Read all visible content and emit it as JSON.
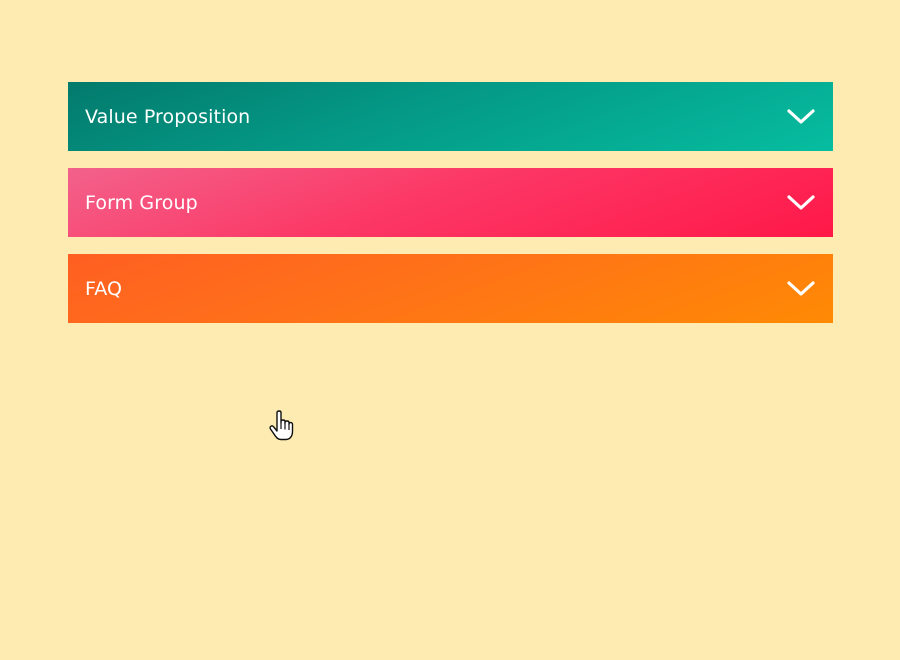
{
  "accordion": {
    "items": [
      {
        "label": "Value Proposition",
        "icon": "chevron-down-icon",
        "color": "#049a87"
      },
      {
        "label": "Form Group",
        "icon": "chevron-down-icon",
        "color": "#fc3866"
      },
      {
        "label": "FAQ",
        "icon": "chevron-down-icon",
        "color": "#ff7218"
      }
    ]
  },
  "colors": {
    "background": "#feebb1"
  },
  "cursor": {
    "icon": "hand-pointer-icon"
  }
}
